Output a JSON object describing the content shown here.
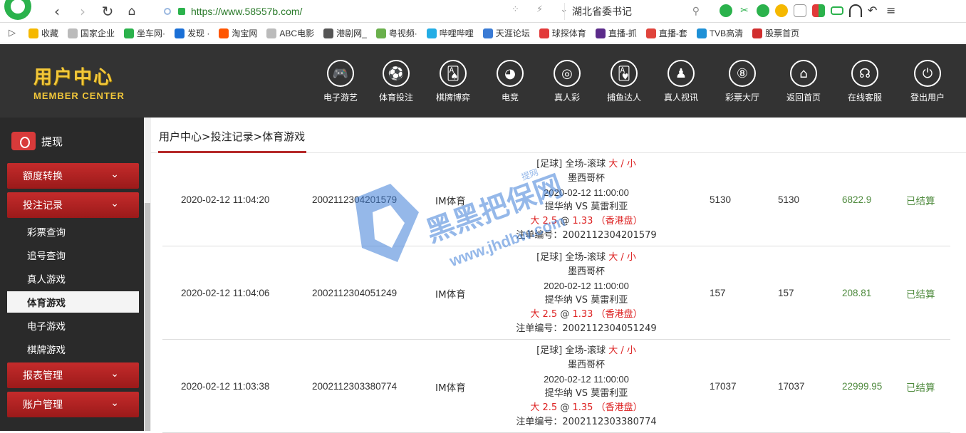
{
  "browser": {
    "url": "https://www.58557b.com/",
    "search_text": "湖北省委书记",
    "bookmarks_toggle": "▷",
    "bookmarks": [
      {
        "label": "收藏",
        "color": "#f5b800"
      },
      {
        "label": "国家企业",
        "color": "#bbbbbb"
      },
      {
        "label": "坐车网·",
        "color": "#2bb24c"
      },
      {
        "label": "发现 ·",
        "color": "#1a6fd6"
      },
      {
        "label": "淘宝网",
        "color": "#ff5500"
      },
      {
        "label": "ABC电影",
        "color": "#bbbbbb"
      },
      {
        "label": "港剧网_",
        "color": "#555555"
      },
      {
        "label": "粤视频·",
        "color": "#6ab04c"
      },
      {
        "label": "哔哩哔哩",
        "color": "#23ade5"
      },
      {
        "label": "天涯论坛",
        "color": "#3a7bd5"
      },
      {
        "label": "球探体育",
        "color": "#e23a3a"
      },
      {
        "label": "直播-抓",
        "color": "#5b2b8a"
      },
      {
        "label": "直播-套",
        "color": "#e0443c"
      },
      {
        "label": "TVB高清",
        "color": "#1e90d6"
      },
      {
        "label": "股票首页",
        "color": "#d12e2e"
      }
    ]
  },
  "header": {
    "logo_cn": "用户中心",
    "logo_en": "MEMBER CENTER",
    "nav": [
      {
        "label": "电子游艺",
        "icon": "🎮"
      },
      {
        "label": "体育投注",
        "icon": "⚽"
      },
      {
        "label": "棋牌博弈",
        "icon": "🂡"
      },
      {
        "label": "电竞",
        "icon": "◕"
      },
      {
        "label": "真人彩",
        "icon": "◎"
      },
      {
        "label": "捕鱼达人",
        "icon": "🂱"
      },
      {
        "label": "真人视讯",
        "icon": "♟"
      },
      {
        "label": "彩票大厅",
        "icon": "⑧"
      },
      {
        "label": "返回首页",
        "icon": "⌂"
      },
      {
        "label": "在线客服",
        "icon": "☊"
      },
      {
        "label": "登出用户",
        "icon": "⏻"
      }
    ]
  },
  "sidebar": {
    "withdraw": "提现",
    "categories": [
      "额度转换",
      "投注记录",
      "报表管理",
      "账户管理"
    ],
    "sub_items": [
      "彩票查询",
      "追号查询",
      "真人游戏",
      "体育游戏",
      "电子游戏",
      "棋牌游戏"
    ],
    "active_sub": "体育游戏",
    "chevron": "⌄"
  },
  "content": {
    "breadcrumb": "用户中心>投注记录>体育游戏",
    "rows": [
      {
        "time": "2020-02-12 11:04:20",
        "bet_no": "2002112304201579",
        "platform": "IM体育",
        "sport_prefix": "[足球] 全场-滚球",
        "market": "大 / 小",
        "league": "墨西哥杯",
        "match_time": "2020-02-12 11:00:00",
        "teams": "提华纳 VS 莫雷利亚",
        "pick": "大 2.5",
        "odds": "1.33",
        "odds_type": "（香港盘）",
        "order_no": "注单编号：2002112304201579",
        "bet": "5130",
        "valid": "5130",
        "win": "6822.9",
        "status": "已结算"
      },
      {
        "time": "2020-02-12 11:04:06",
        "bet_no": "2002112304051249",
        "platform": "IM体育",
        "sport_prefix": "[足球] 全场-滚球",
        "market": "大 / 小",
        "league": "墨西哥杯",
        "match_time": "2020-02-12 11:00:00",
        "teams": "提华纳 VS 莫雷利亚",
        "pick": "大 2.5",
        "odds": "1.33",
        "odds_type": "（香港盘）",
        "order_no": "注单编号：2002112304051249",
        "bet": "157",
        "valid": "157",
        "win": "208.81",
        "status": "已结算"
      },
      {
        "time": "2020-02-12 11:03:38",
        "bet_no": "2002112303380774",
        "platform": "IM体育",
        "sport_prefix": "[足球] 全场-滚球",
        "market": "大 / 小",
        "league": "墨西哥杯",
        "match_time": "2020-02-12 11:00:00",
        "teams": "提华纳 VS 莫雷利亚",
        "pick": "大 2.5",
        "odds": "1.35",
        "odds_type": "（香港盘）",
        "order_no": "注单编号：2002112303380774",
        "bet": "17037",
        "valid": "17037",
        "win": "22999.95",
        "status": "已结算"
      }
    ]
  },
  "watermark": {
    "text_cn": "黑黑把保网",
    "text_en": "www.jhdbw.com",
    "corner": "提网",
    "color": "#3f7fd8"
  }
}
